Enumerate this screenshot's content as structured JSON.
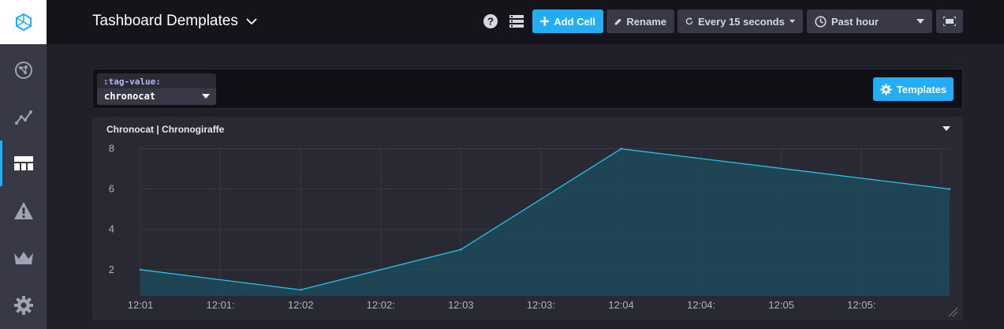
{
  "header": {
    "title": "Tashboard Demplates",
    "add_cell_label": "Add Cell",
    "rename_label": "Rename",
    "refresh_label": "Every 15 seconds",
    "range_label": "Past hour"
  },
  "template_bar": {
    "tag_label": ":tag-value:",
    "tag_value": "chronocat",
    "templates_label": "Templates"
  },
  "cell": {
    "title": "Chronocat | Chronogiraffe"
  },
  "colors": {
    "accent": "#22adf6",
    "series_line": "#22c6f0",
    "series_fill": "#1d4a5c"
  },
  "chart_data": {
    "type": "area",
    "title": "Chronocat | Chronogiraffe",
    "xlabel": "",
    "ylabel": "",
    "x_tick_labels": [
      "12:01",
      "12:01:",
      "12:02",
      "12:02:",
      "12:03",
      "12:03:",
      "12:04",
      "12:04:",
      "12:05",
      "12:05:"
    ],
    "y_ticks": [
      2,
      4,
      6,
      8
    ],
    "ylim": [
      0.7,
      8.1
    ],
    "x_index_range": [
      0,
      10.1
    ],
    "series": [
      {
        "x_index": [
          0,
          2,
          4,
          6,
          10.1
        ],
        "values": [
          2,
          1,
          3,
          8,
          6
        ]
      }
    ],
    "grid": true,
    "legend": "none"
  }
}
